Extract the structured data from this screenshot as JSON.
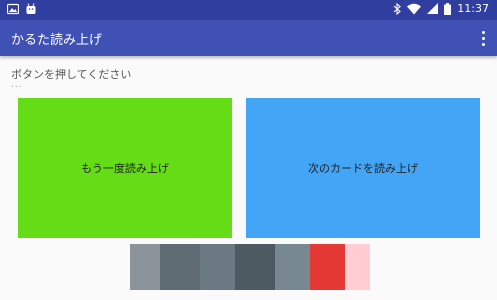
{
  "status_bar": {
    "time": "11:37",
    "colors": {
      "background": "#303f9f"
    },
    "icons": [
      "photo-notification-icon",
      "android-notification-icon",
      "bluetooth-icon",
      "wifi-icon",
      "signal-icon",
      "battery-icon"
    ]
  },
  "app_bar": {
    "title": "かるた読み上げ",
    "colors": {
      "background": "#3f51b5"
    },
    "overflow_icon": "more-vert-icon"
  },
  "main": {
    "prompt": "ボタンを押してください",
    "status_text": "...",
    "buttons": [
      {
        "label": "もう一度読み上げ",
        "color": "#64dd17"
      },
      {
        "label": "次のカードを読み上げ",
        "color": "#42a5f5"
      }
    ]
  },
  "ad_banner": {
    "colors": [
      "#8a949a",
      "#5f6c74",
      "#6b7a82",
      "#4d5a62",
      "#788890",
      "#e53935",
      "#ffcdd2"
    ]
  }
}
